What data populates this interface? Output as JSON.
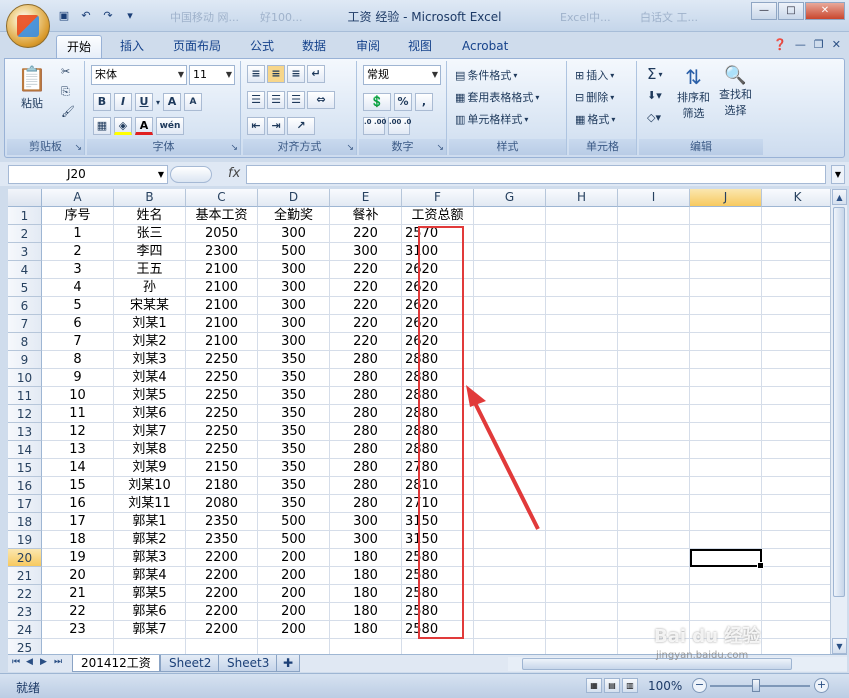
{
  "window": {
    "title": "工资 经验 - Microsoft Excel",
    "ghost_tabs": [
      "中国移动 网...",
      "好100...",
      "Excel中...",
      "白话文 工..."
    ]
  },
  "ribbon": {
    "tabs": [
      "开始",
      "插入",
      "页面布局",
      "公式",
      "数据",
      "审阅",
      "视图",
      "Acrobat"
    ],
    "active_tab": "开始",
    "groups": {
      "clipboard": {
        "label": "剪贴板",
        "paste": "粘贴"
      },
      "font": {
        "label": "字体",
        "font_name": "宋体",
        "font_size": "11",
        "bold": "B",
        "italic": "I",
        "underline": "U",
        "grow": "A",
        "shrink": "A",
        "wen": "wén"
      },
      "alignment": {
        "label": "对齐方式"
      },
      "number": {
        "label": "数字",
        "format": "常规",
        "percent": "%",
        "comma": ",",
        "inc_dec": ".0 .00",
        "dec_dec": ".00 .0"
      },
      "styles": {
        "label": "样式",
        "cond_format": "条件格式",
        "table_format": "套用表格格式",
        "cell_styles": "单元格样式"
      },
      "cells": {
        "label": "单元格",
        "insert": "插入",
        "delete": "删除",
        "format": "格式"
      },
      "editing": {
        "label": "编辑",
        "sum": "Σ",
        "sort_filter": "排序和",
        "filter2": "筛选",
        "find_select": "查找和",
        "select2": "选择"
      }
    }
  },
  "formula_bar": {
    "name_box": "J20",
    "fx": "fx",
    "value": ""
  },
  "sheet": {
    "columns": [
      "A",
      "B",
      "C",
      "D",
      "E",
      "F",
      "G",
      "H",
      "I",
      "J",
      "K"
    ],
    "selected_column": "J",
    "selected_row": "20",
    "header": [
      "序号",
      "姓名",
      "基本工资",
      "全勤奖",
      "餐补",
      "工资总额"
    ],
    "rows": [
      [
        "1",
        "张三",
        "2050",
        "300",
        "220",
        "2570"
      ],
      [
        "2",
        "李四",
        "2300",
        "500",
        "300",
        "3100"
      ],
      [
        "3",
        "王五",
        "2100",
        "300",
        "220",
        "2620"
      ],
      [
        "4",
        "孙",
        "2100",
        "300",
        "220",
        "2620"
      ],
      [
        "5",
        "宋某某",
        "2100",
        "300",
        "220",
        "2620"
      ],
      [
        "6",
        "刘某1",
        "2100",
        "300",
        "220",
        "2620"
      ],
      [
        "7",
        "刘某2",
        "2100",
        "300",
        "220",
        "2620"
      ],
      [
        "8",
        "刘某3",
        "2250",
        "350",
        "280",
        "2880"
      ],
      [
        "9",
        "刘某4",
        "2250",
        "350",
        "280",
        "2880"
      ],
      [
        "10",
        "刘某5",
        "2250",
        "350",
        "280",
        "2880"
      ],
      [
        "11",
        "刘某6",
        "2250",
        "350",
        "280",
        "2880"
      ],
      [
        "12",
        "刘某7",
        "2250",
        "350",
        "280",
        "2880"
      ],
      [
        "13",
        "刘某8",
        "2250",
        "350",
        "280",
        "2880"
      ],
      [
        "14",
        "刘某9",
        "2150",
        "350",
        "280",
        "2780"
      ],
      [
        "15",
        "刘某10",
        "2180",
        "350",
        "280",
        "2810"
      ],
      [
        "16",
        "刘某11",
        "2080",
        "350",
        "280",
        "2710"
      ],
      [
        "17",
        "郭某1",
        "2350",
        "500",
        "300",
        "3150"
      ],
      [
        "18",
        "郭某2",
        "2350",
        "500",
        "300",
        "3150"
      ],
      [
        "19",
        "郭某3",
        "2200",
        "200",
        "180",
        "2580"
      ],
      [
        "20",
        "郭某4",
        "2200",
        "200",
        "180",
        "2580"
      ],
      [
        "21",
        "郭某5",
        "2200",
        "200",
        "180",
        "2580"
      ],
      [
        "22",
        "郭某6",
        "2200",
        "200",
        "180",
        "2580"
      ],
      [
        "23",
        "郭某7",
        "2200",
        "200",
        "180",
        "2580"
      ]
    ],
    "row_numbers": [
      "1",
      "2",
      "3",
      "4",
      "5",
      "6",
      "7",
      "8",
      "9",
      "10",
      "11",
      "12",
      "13",
      "14",
      "15",
      "16",
      "17",
      "18",
      "19",
      "20",
      "21",
      "22",
      "23",
      "24",
      "25"
    ]
  },
  "sheet_tabs": [
    "201412工资",
    "Sheet2",
    "Sheet3"
  ],
  "active_sheet": "201412工资",
  "status": {
    "text": "就绪",
    "zoom": "100%"
  },
  "watermark": {
    "main": "Bai du 经验",
    "sub": "jingyan.baidu.com"
  },
  "colors": {
    "highlight_box": "#e13a3a",
    "selection_header": "#f7c95f"
  }
}
